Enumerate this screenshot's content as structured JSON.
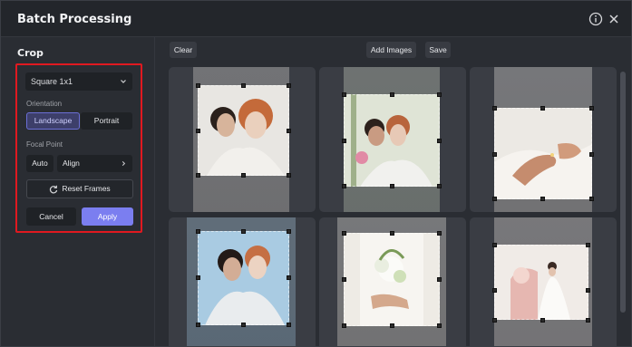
{
  "window": {
    "title": "Batch Processing",
    "icons": [
      "info-icon",
      "close-icon"
    ]
  },
  "left_panel": {
    "section_title": "Crop",
    "aspect_select": {
      "value": "Square 1x1",
      "icon": "chevron-down-icon"
    },
    "orientation": {
      "label": "Orientation",
      "options": [
        "Landscape",
        "Portrait"
      ],
      "selected": "Landscape"
    },
    "focal_point": {
      "label": "Focal Point",
      "auto_label": "Auto",
      "align_label": "Align",
      "align_icon": "chevron-right-icon"
    },
    "reset_label": "Reset Frames",
    "reset_icon": "refresh-icon",
    "cancel_label": "Cancel",
    "apply_label": "Apply",
    "highlight_color": "#e01920",
    "accent_color": "#7b7ef0"
  },
  "toolbar": {
    "clear_label": "Clear",
    "add_images_label": "Add Images",
    "save_label": "Save"
  },
  "images": [
    {
      "subject": "two women portrait"
    },
    {
      "subject": "two women with flowers"
    },
    {
      "subject": "hands with ring"
    },
    {
      "subject": "two women embracing"
    },
    {
      "subject": "bride holding bouquet"
    },
    {
      "subject": "bride with pink decor"
    }
  ]
}
